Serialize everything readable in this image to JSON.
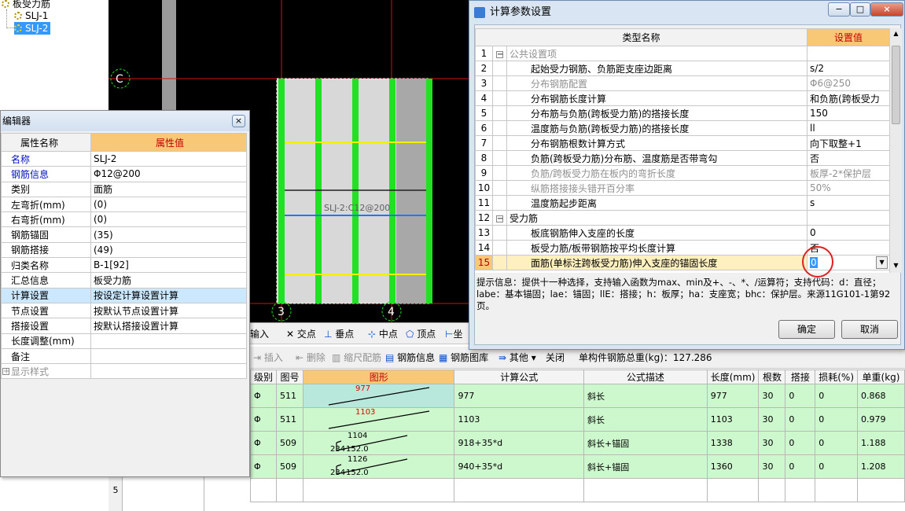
{
  "tree": {
    "root": "板受力筋",
    "items": [
      "SLJ-1",
      "SLJ-2"
    ]
  },
  "cad": {
    "axis_c": "C",
    "axis_3": "3",
    "axis_4": "4",
    "rebar_label": "SLJ-2:C12@200"
  },
  "toolbar1": {
    "input": "输入",
    "intersection": "交点",
    "perpendicular": "垂点",
    "midpoint": "中点",
    "vertex": "顶点",
    "more": "坐"
  },
  "toolbar2": {
    "insert": "插入",
    "delete": "删除",
    "scale": "缩尺配筋",
    "rebar_info": "钢筋信息",
    "rebar_lib": "钢筋图库",
    "other": "其他",
    "close": "关闭",
    "total": "单构件钢筋总重(kg)：127.286"
  },
  "rebar_grid": {
    "headers": [
      "级别",
      "图号",
      "图形",
      "计算公式",
      "公式描述",
      "长度(mm)",
      "根数",
      "搭接",
      "损耗(%)",
      "单重(kg)"
    ],
    "rows": [
      {
        "grade": "Φ",
        "fig": "511",
        "shape_top": "977",
        "formula": "977",
        "desc": "斜长",
        "length": "977",
        "count": "30",
        "lap": "0",
        "loss": "0",
        "weight": "0.868"
      },
      {
        "grade": "Φ",
        "fig": "511",
        "shape_top": "1103",
        "formula": "1103",
        "desc": "斜长",
        "length": "1103",
        "count": "30",
        "lap": "0",
        "loss": "0",
        "weight": "0.979"
      },
      {
        "grade": "Φ",
        "fig": "509",
        "shape_top": "1104",
        "shape_left": "234",
        "shape_right": "152.0",
        "formula": "918+35*d",
        "desc": "斜长+锚固",
        "length": "1338",
        "count": "30",
        "lap": "0",
        "loss": "0",
        "weight": "1.188"
      },
      {
        "grade": "Φ",
        "fig": "509",
        "shape_top": "1126",
        "shape_left": "234",
        "shape_right": "152.0",
        "formula": "940+35*d",
        "desc": "斜长+锚固",
        "length": "1360",
        "count": "30",
        "lap": "0",
        "loss": "0",
        "weight": "1.208"
      }
    ],
    "last_row_no": "5"
  },
  "prop_editor": {
    "title": "编辑器",
    "col_name": "属性名称",
    "col_value": "属性值",
    "rows": [
      {
        "name": "名称",
        "value": "SLJ-2",
        "blue": true
      },
      {
        "name": "钢筋信息",
        "value": "Φ12@200",
        "blue": true
      },
      {
        "name": "类别",
        "value": "面筋"
      },
      {
        "name": "左弯折(mm)",
        "value": "(0)"
      },
      {
        "name": "右弯折(mm)",
        "value": "(0)"
      },
      {
        "name": "钢筋锚固",
        "value": "(35)"
      },
      {
        "name": "钢筋搭接",
        "value": "(49)"
      },
      {
        "name": "归类名称",
        "value": "B-1[92]"
      },
      {
        "name": "汇总信息",
        "value": "板受力筋"
      },
      {
        "name": "计算设置",
        "value": "按设定计算设置计算",
        "sel": true
      },
      {
        "name": "节点设置",
        "value": "按默认节点设置计算"
      },
      {
        "name": "搭接设置",
        "value": "按默认搭接设置计算"
      },
      {
        "name": "长度调整(mm)",
        "value": ""
      },
      {
        "name": "备注",
        "value": ""
      },
      {
        "name": "显示样式",
        "value": "",
        "expand": "+",
        "gray": true
      }
    ]
  },
  "dialog": {
    "title": "计算参数设置",
    "col_type": "类型名称",
    "col_value": "设置值",
    "rows": [
      {
        "no": "1",
        "name": "公共设置项",
        "value": "",
        "group": "−",
        "gray": true
      },
      {
        "no": "2",
        "name": "起始受力钢筋、负筋距支座边距离",
        "value": "s/2"
      },
      {
        "no": "3",
        "name": "分布钢筋配置",
        "value": "Φ6@250",
        "gray": true
      },
      {
        "no": "4",
        "name": "分布钢筋长度计算",
        "value": "和负筋(跨板受力"
      },
      {
        "no": "5",
        "name": "分布筋与负筋(跨板受力筋)的搭接长度",
        "value": "150"
      },
      {
        "no": "6",
        "name": "温度筋与负筋(跨板受力筋)的搭接长度",
        "value": "ll"
      },
      {
        "no": "7",
        "name": "分布钢筋根数计算方式",
        "value": "向下取整+1"
      },
      {
        "no": "8",
        "name": "负筋(跨板受力筋)分布筋、温度筋是否带弯勾",
        "value": "否"
      },
      {
        "no": "9",
        "name": "负筋/跨板受力筋在板内的弯折长度",
        "value": "板厚-2*保护层",
        "gray": true
      },
      {
        "no": "10",
        "name": "纵筋搭接接头错开百分率",
        "value": "50%",
        "gray": true
      },
      {
        "no": "11",
        "name": "温度筋起步距离",
        "value": "s"
      },
      {
        "no": "12",
        "name": "受力筋",
        "value": "",
        "group": "−"
      },
      {
        "no": "13",
        "name": "板底钢筋伸入支座的长度",
        "value": "0"
      },
      {
        "no": "14",
        "name": "板受力筋/板带钢筋按平均长度计算",
        "value": "否"
      },
      {
        "no": "15",
        "name": "面筋(单标注跨板受力筋)伸入支座的锚固长度",
        "value": "0",
        "sel": true
      }
    ],
    "hint": "提示信息：提供十一种选择，支持输入函数为max、min及+、-、*、/运算符；支持代码：d：直径；labe：基本锚固；lae：锚固；llE：搭接；h：板厚；ha：支座宽；bhc：保护层。来源11G101-1第92页。",
    "ok": "确定",
    "cancel": "取消",
    "btn_min": "−",
    "btn_max": "□",
    "btn_close": "×"
  },
  "pe_close": "×"
}
